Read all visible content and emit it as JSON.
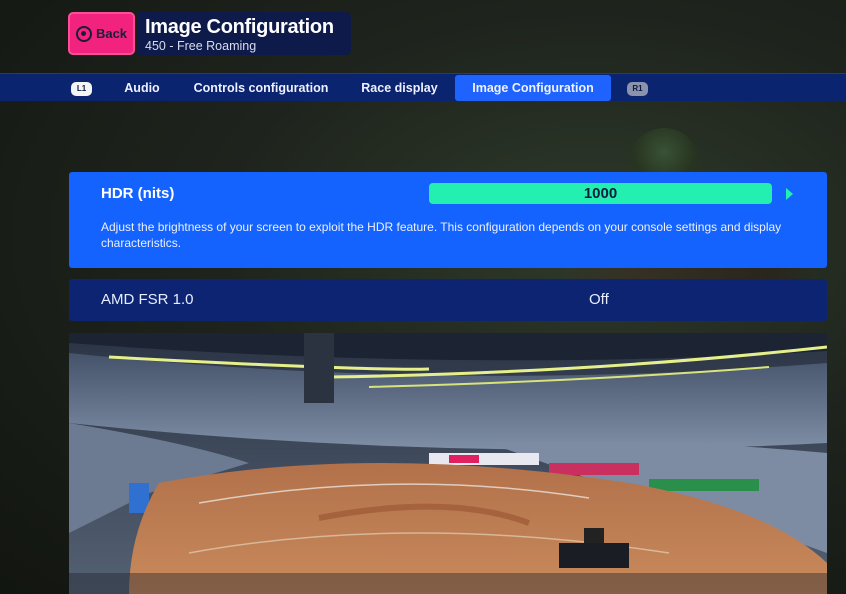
{
  "header": {
    "back_label": "Back",
    "title": "Image Configuration",
    "subtitle": "450 - Free Roaming"
  },
  "tabs": {
    "left_hint": "L1",
    "right_hint": "R1",
    "items": [
      {
        "label": "Audio"
      },
      {
        "label": "Controls configuration"
      },
      {
        "label": "Race display"
      },
      {
        "label": "Image Configuration",
        "active": true
      }
    ]
  },
  "settings": {
    "hdr": {
      "label": "HDR (nits)",
      "value": "1000",
      "description": "Adjust the brightness of your screen to exploit the HDR feature. This configuration depends on your console settings and display characteristics."
    },
    "fsr": {
      "label": "AMD FSR 1.0",
      "value": "Off"
    }
  },
  "colors": {
    "accent_pink": "#f2237e",
    "selected_blue": "#1463ff",
    "tabbar_blue": "#0b2470",
    "slider_green": "#23f0b0"
  },
  "icons": {
    "back": "circle-button-icon",
    "slider_next": "arrow-right-icon"
  }
}
